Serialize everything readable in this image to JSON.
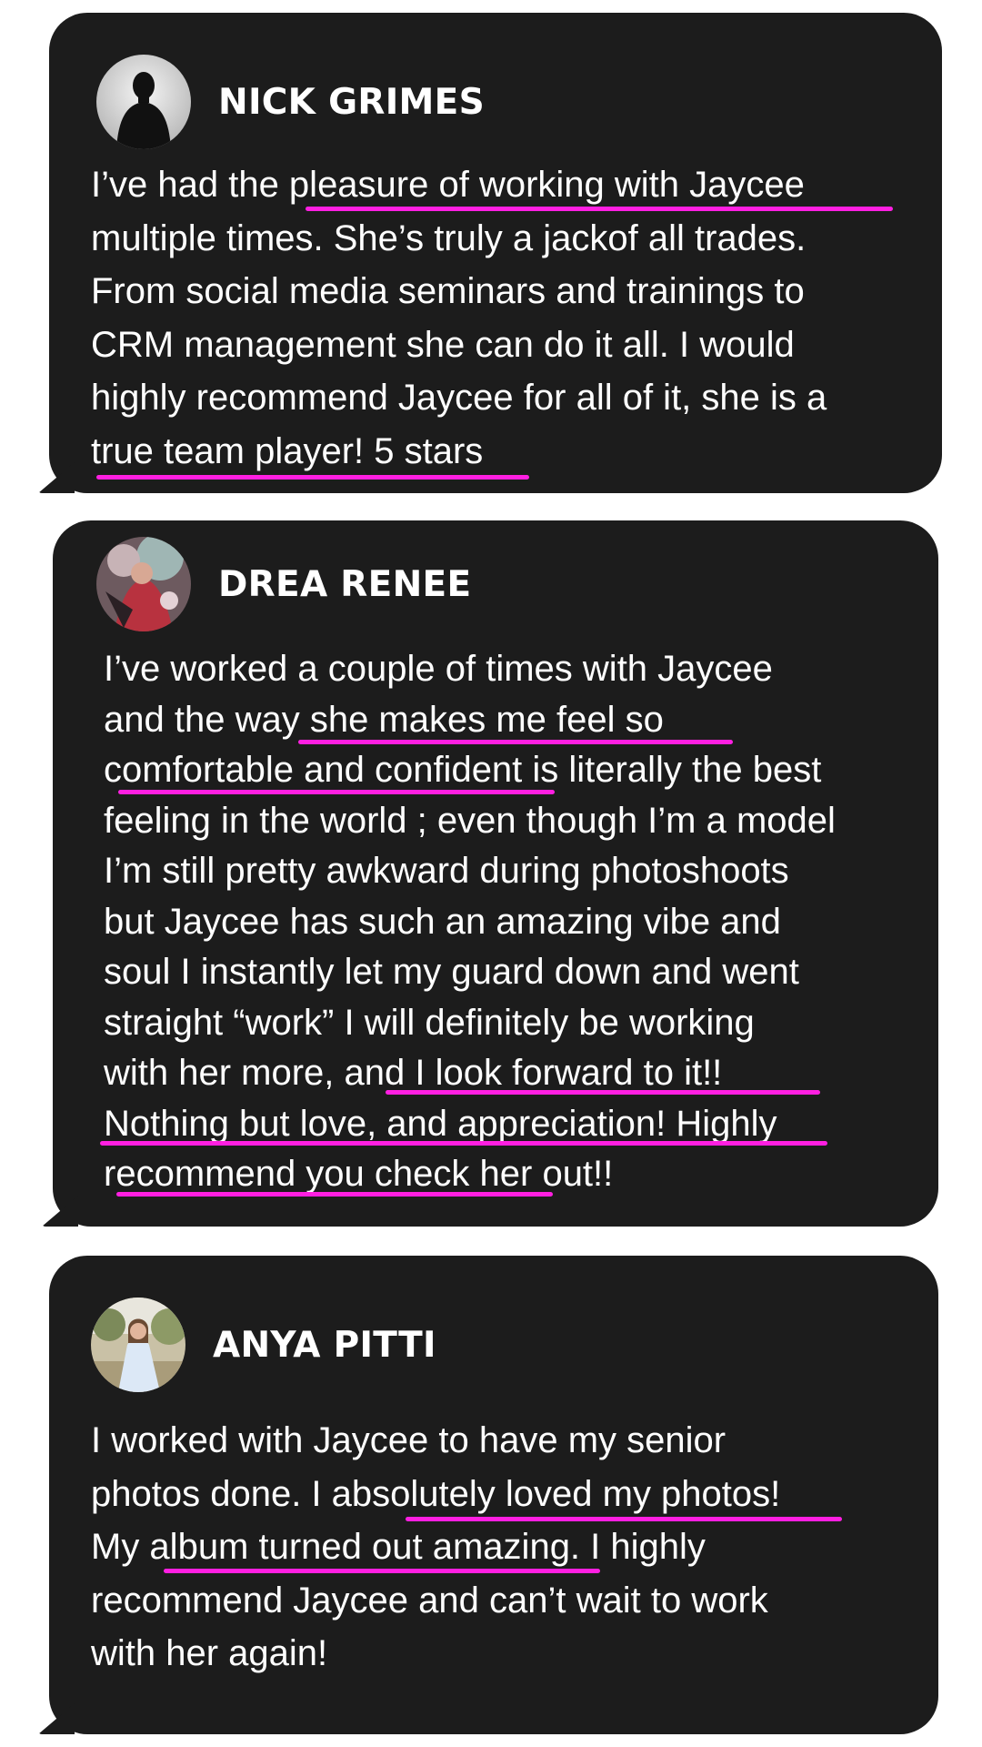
{
  "colors": {
    "card_background": "#1c1c1c",
    "page_background": "#ffffff",
    "text": "#ffffff",
    "highlight": "#ff1fe1"
  },
  "testimonials": [
    {
      "name": "NICK GRIMES",
      "avatar_icon": "person-silhouette-avatar",
      "lines": [
        "I’ve had the pleasure of working with Jaycee",
        "multiple times. She’s truly a jackof all trades.",
        "From social media seminars and trainings to",
        "CRM management she can do it all. I would",
        "highly recommend Jaycee for all of it, she is a",
        "true team player! 5 stars"
      ]
    },
    {
      "name": "DREA RENEE",
      "avatar_icon": "photo-avatar",
      "lines": [
        "I’ve worked a couple of times with Jaycee",
        "and the way she makes me feel so",
        "comfortable and confident is literally the best",
        "feeling in the world ; even though I’m a model",
        "I’m still pretty awkward during photoshoots",
        "but Jaycee has such an amazing vibe and",
        "soul I instantly let my guard down and went",
        "straight “work” I will definitely be working",
        "with her more, and I look forward to it!!",
        "Nothing but love, and appreciation! Highly",
        "recommend you check her out!!"
      ]
    },
    {
      "name": "ANYA PITTI",
      "avatar_icon": "photo-avatar",
      "lines": [
        "I worked with Jaycee to have my senior",
        "photos done. I absolutely loved my photos!",
        "My album turned out amazing. I highly",
        "recommend Jaycee and can’t wait to work",
        "with her again!"
      ]
    }
  ]
}
